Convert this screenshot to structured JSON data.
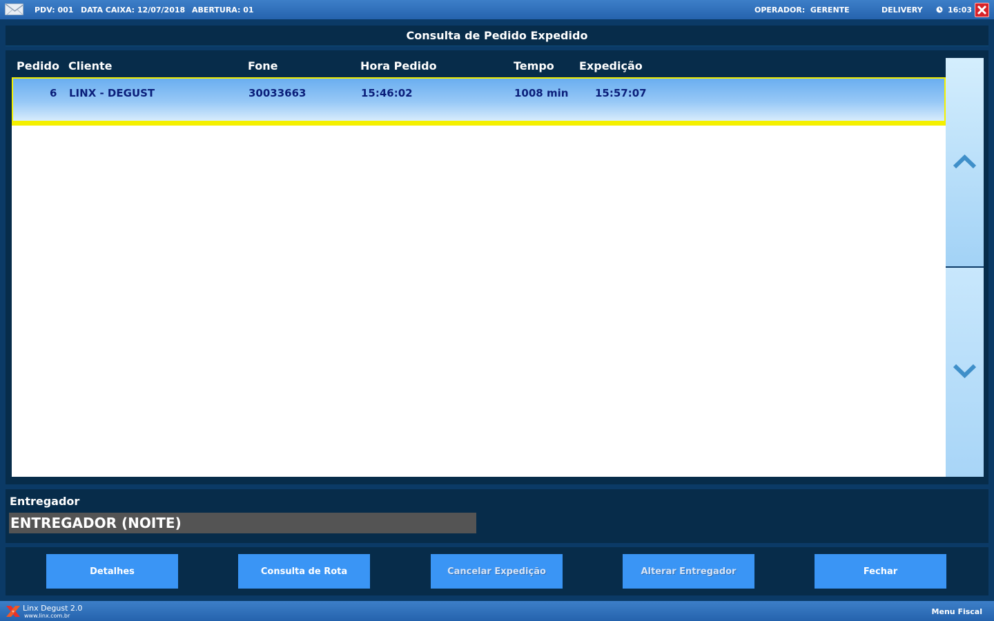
{
  "topbar": {
    "pdv": "PDV: 001",
    "data_caixa": "DATA CAIXA: 12/07/2018",
    "abertura": "ABERTURA: 01",
    "operador": "OPERADOR:  GERENTE",
    "mode": "DELIVERY",
    "time": "16:03",
    "icons": [
      "mail-icon",
      "clock-icon",
      "close-icon"
    ]
  },
  "window": {
    "title": "Consulta de Pedido Expedido"
  },
  "table": {
    "columns": [
      "Pedido",
      "Cliente",
      "Fone",
      "Hora Pedido",
      "Tempo",
      "Expedição"
    ],
    "rows": [
      {
        "pedido": "6",
        "cliente": "LINX - DEGUST",
        "fone": "30033663",
        "hora_pedido": "15:46:02",
        "tempo": "1008 min",
        "expedicao": "15:57:07",
        "selected": true
      }
    ]
  },
  "courier": {
    "label": "Entregador",
    "value": "ENTREGADOR (NOITE)"
  },
  "buttons": {
    "detalhes": "Detalhes",
    "consulta_rota": "Consulta de Rota",
    "cancelar_expedicao": "Cancelar Expedição",
    "alterar_entregador": "Alterar Entregador",
    "fechar": "Fechar"
  },
  "footer": {
    "brand": "Linx Degust 2.0",
    "url": "www.linx.com.br",
    "menu": "Menu Fiscal"
  },
  "colors": {
    "panel": "#072c4a",
    "button": "#3a95f5",
    "selection_border": "#f4f000",
    "row_text": "#0b1f7a"
  }
}
